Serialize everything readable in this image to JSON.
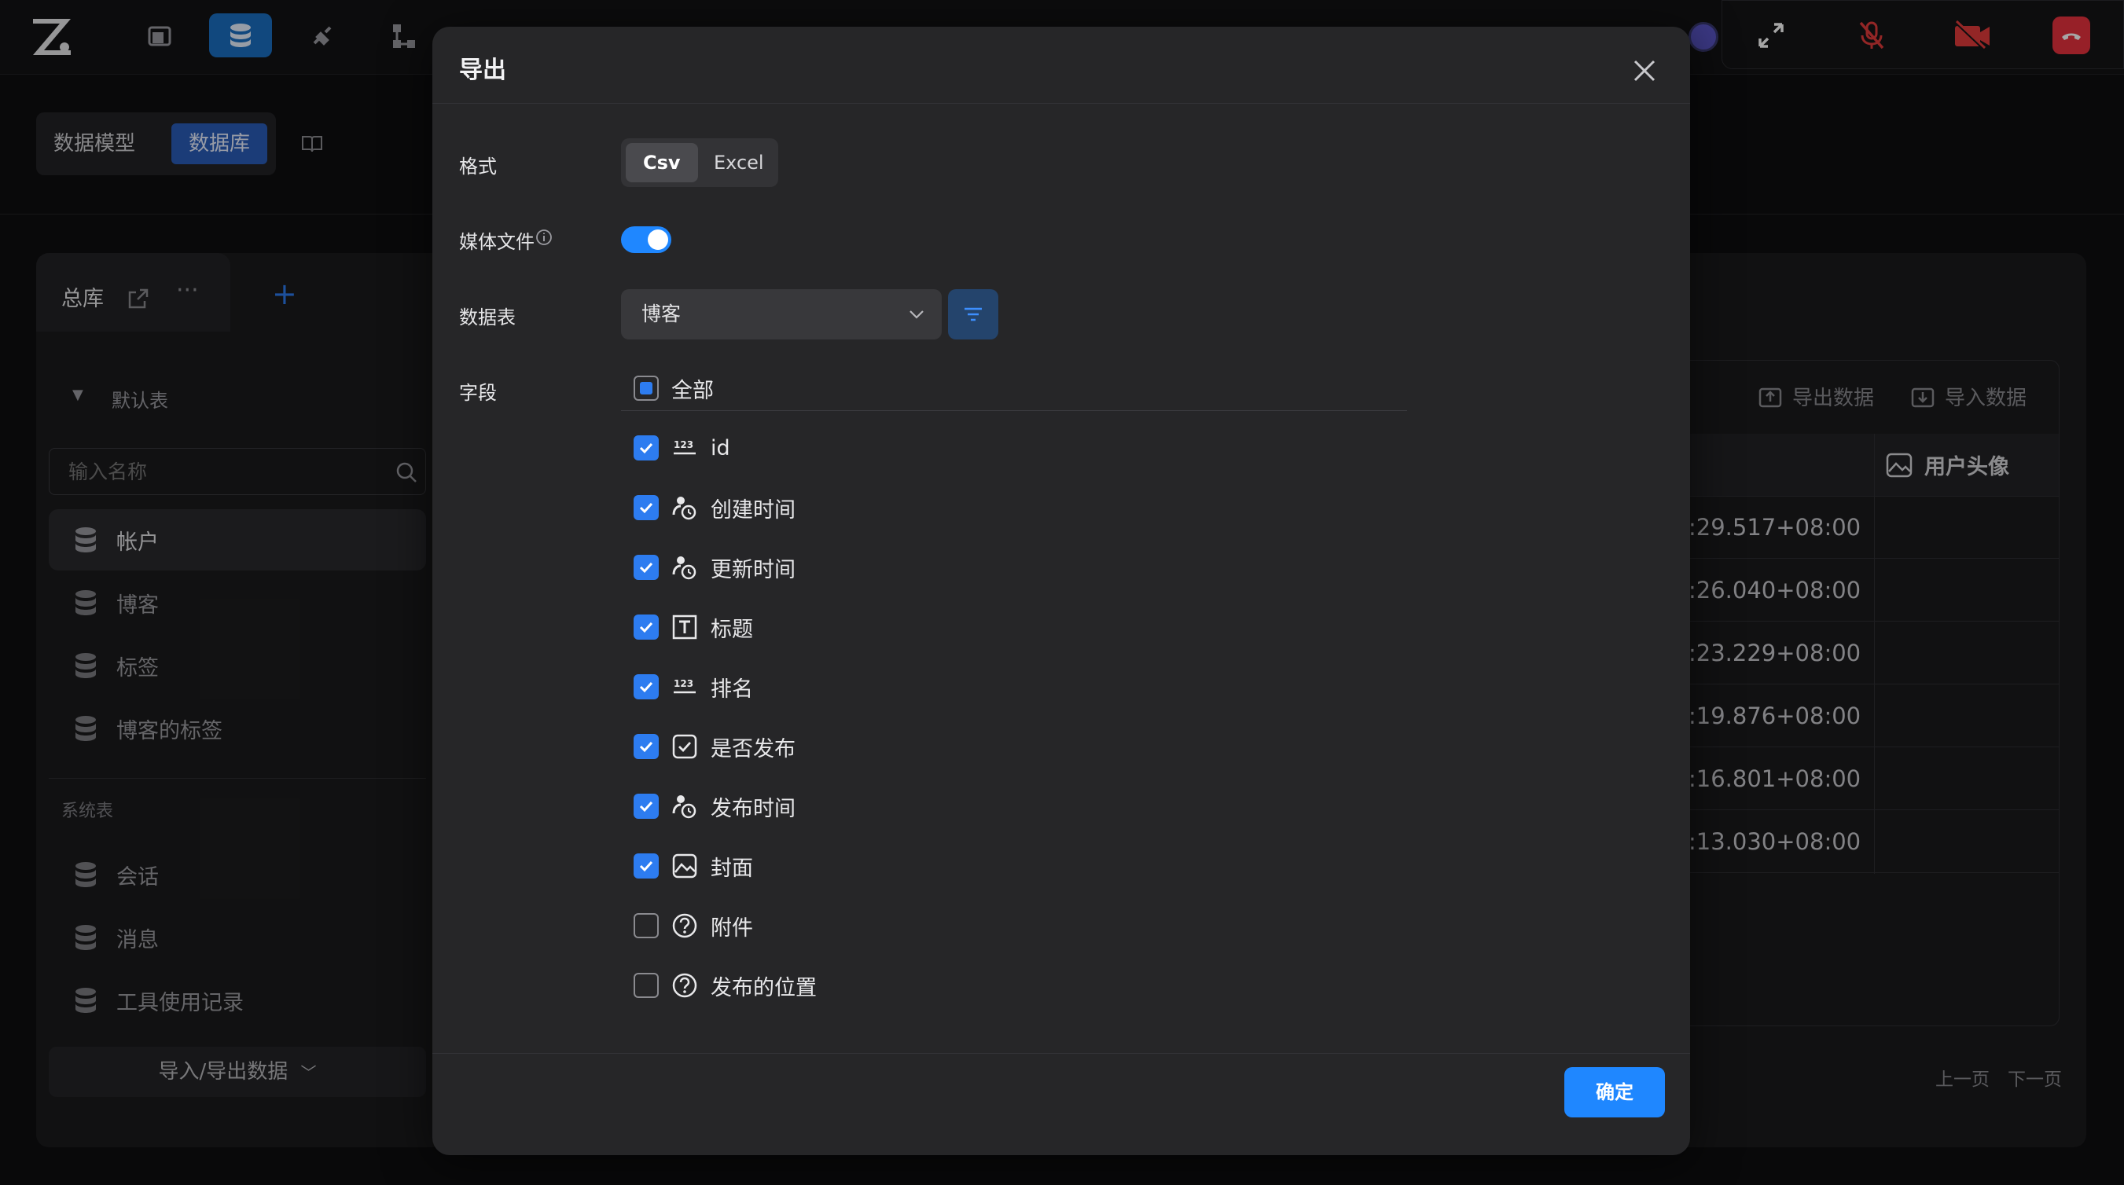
{
  "subheader": {
    "tabs": [
      "数据模型",
      "数据库"
    ],
    "active_tab": "数据库"
  },
  "left_panel": {
    "tab_title": "总库",
    "group_default": "默认表",
    "search_placeholder": "输入名称",
    "default_tables": [
      "帐户",
      "博客",
      "标签",
      "博客的标签"
    ],
    "group_system": "系统表",
    "system_tables": [
      "会话",
      "消息",
      "工具使用记录"
    ],
    "import_export": "导入/导出数据"
  },
  "right_panel": {
    "export_data": "导出数据",
    "import_data": "导入数据",
    "column": "用户头像",
    "timestamps": [
      ":29.517+08:00",
      ":26.040+08:00",
      ":23.229+08:00",
      ":19.876+08:00",
      ":16.801+08:00",
      ":13.030+08:00"
    ],
    "prev": "上一页",
    "next": "下一页"
  },
  "dialog": {
    "title": "导出",
    "format_label": "格式",
    "formats": [
      "Csv",
      "Excel"
    ],
    "active_format": "Csv",
    "media_label": "媒体文件",
    "media_enabled": true,
    "table_label": "数据表",
    "table_value": "博客",
    "fields_label": "字段",
    "all_label": "全部",
    "fields": [
      {
        "name": "id",
        "type": "number-icon",
        "checked": true
      },
      {
        "name": "创建时间",
        "type": "datetime-icon",
        "checked": true
      },
      {
        "name": "更新时间",
        "type": "datetime-icon",
        "checked": true
      },
      {
        "name": "标题",
        "type": "text-icon",
        "checked": true
      },
      {
        "name": "排名",
        "type": "number-icon",
        "checked": true
      },
      {
        "name": "是否发布",
        "type": "checkbox-type-icon",
        "checked": true
      },
      {
        "name": "发布时间",
        "type": "datetime-icon",
        "checked": true
      },
      {
        "name": "封面",
        "type": "image-icon",
        "checked": true
      },
      {
        "name": "附件",
        "type": "unknown-icon",
        "checked": false
      },
      {
        "name": "发布的位置",
        "type": "unknown-icon",
        "checked": false
      }
    ],
    "confirm": "确定"
  },
  "colors": {
    "accent": "#1f87ff",
    "checkbox": "#2d7cf0",
    "active_nav": "#1b6fc2"
  }
}
